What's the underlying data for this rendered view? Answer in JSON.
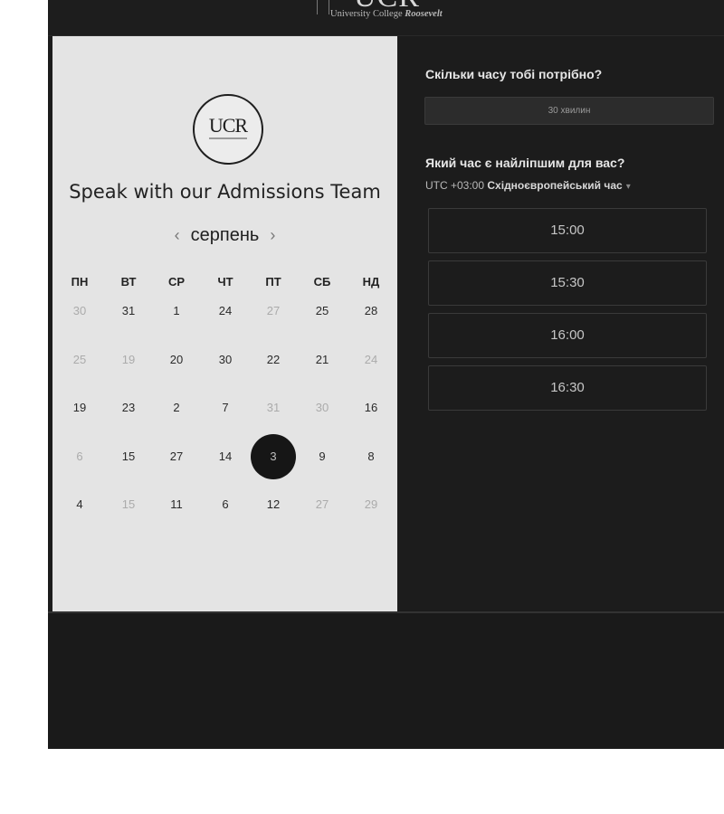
{
  "header": {
    "logo_big": "UCR",
    "logo_small_prefix": "University College ",
    "logo_small_italic": "Roosevelt"
  },
  "calendar": {
    "panel_logo": "UCR",
    "title": "Speak with our Admissions Team",
    "month": "серпень",
    "prev_icon": "‹",
    "next_icon": "›",
    "weekdays": [
      "ПН",
      "ВТ",
      "СР",
      "ЧТ",
      "ПТ",
      "СБ",
      "НД"
    ],
    "rows": [
      [
        {
          "d": "30",
          "m": true
        },
        {
          "d": "31"
        },
        {
          "d": "1"
        },
        {
          "d": "24"
        },
        {
          "d": "27",
          "m": true
        },
        {
          "d": "25"
        },
        {
          "d": "28"
        }
      ],
      [
        {
          "d": "25",
          "m": true
        },
        {
          "d": "19",
          "m": true
        },
        {
          "d": "20"
        },
        {
          "d": "30"
        },
        {
          "d": "22"
        },
        {
          "d": "21"
        },
        {
          "d": "24",
          "m": true
        }
      ],
      [
        {
          "d": "19"
        },
        {
          "d": "23"
        },
        {
          "d": "2"
        },
        {
          "d": "7"
        },
        {
          "d": "31",
          "m": true
        },
        {
          "d": "30",
          "m": true
        },
        {
          "d": "16"
        }
      ],
      [
        {
          "d": "6",
          "m": true
        },
        {
          "d": "15"
        },
        {
          "d": "27"
        },
        {
          "d": "14"
        },
        {
          "d": "3",
          "sel": true
        },
        {
          "d": "9"
        },
        {
          "d": "8"
        }
      ],
      [
        {
          "d": "4"
        },
        {
          "d": "15",
          "m": true
        },
        {
          "d": "11"
        },
        {
          "d": "6"
        },
        {
          "d": "12"
        },
        {
          "d": "27",
          "m": true
        },
        {
          "d": "29",
          "m": true
        }
      ]
    ]
  },
  "booking": {
    "duration_heading": "Скільки часу тобі потрібно?",
    "duration_value": "30 хвилин",
    "time_heading": "Який час є найліпшим для вас?",
    "timezone_offset": "UTC +03:00",
    "timezone_name": "Східноєвропейський час",
    "timezone_caret": "▾",
    "slots": [
      "15:00",
      "15:30",
      "16:00",
      "16:30"
    ]
  }
}
